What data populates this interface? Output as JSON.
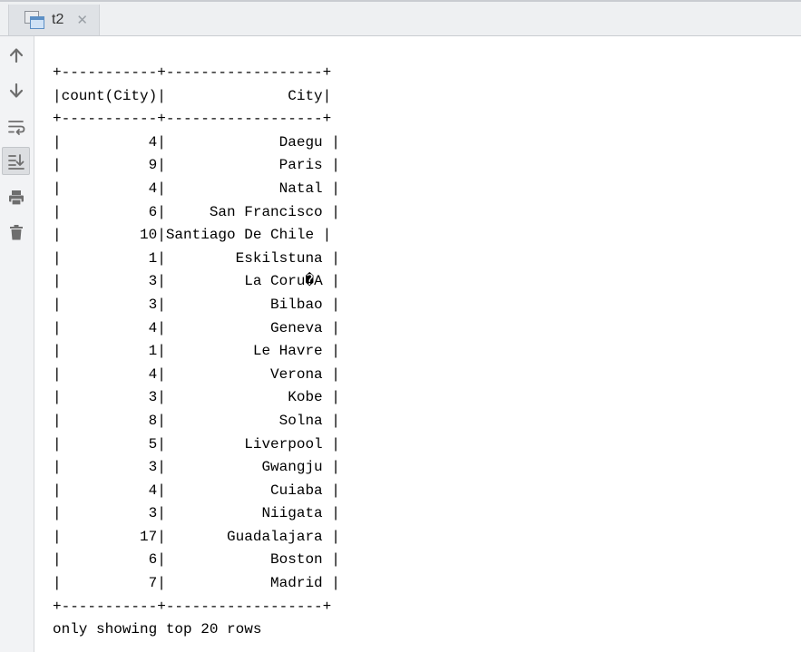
{
  "tab": {
    "title": "t2",
    "icon": "console-window-icon",
    "close_symbol": "✕"
  },
  "toolbar": {
    "icons": [
      "arrow-up-icon",
      "arrow-down-icon",
      "soft-wrap-icon",
      "scroll-to-end-icon",
      "print-icon",
      "trash-icon"
    ],
    "active": "scroll-to-end-icon"
  },
  "output": {
    "border_line": "+-----------+------------------+",
    "header_line": "|count(City)|              City|",
    "rows": [
      "|          4|             Daegu |",
      "|          9|             Paris |",
      "|          4|             Natal |",
      "|          6|     San Francisco |",
      "|         10|Santiago De Chile |",
      "|          1|        Eskilstuna |",
      "|          3|         La Coru�A |",
      "|          3|            Bilbao |",
      "|          4|            Geneva |",
      "|          1|          Le Havre |",
      "|          4|            Verona |",
      "|          3|              Kobe |",
      "|          8|             Solna |",
      "|          5|         Liverpool |",
      "|          3|           Gwangju |",
      "|          4|            Cuiaba |",
      "|          3|           Niigata |",
      "|         17|       Guadalajara |",
      "|          6|            Boston |",
      "|          7|            Madrid |"
    ],
    "footer": "only showing top 20 rows"
  },
  "colors": {
    "tab_bar": "#eef0f2",
    "tab_active": "#dfe2e6",
    "sidebar": "#f2f3f5",
    "icon": "#6e6e6e",
    "text": "#000000"
  }
}
